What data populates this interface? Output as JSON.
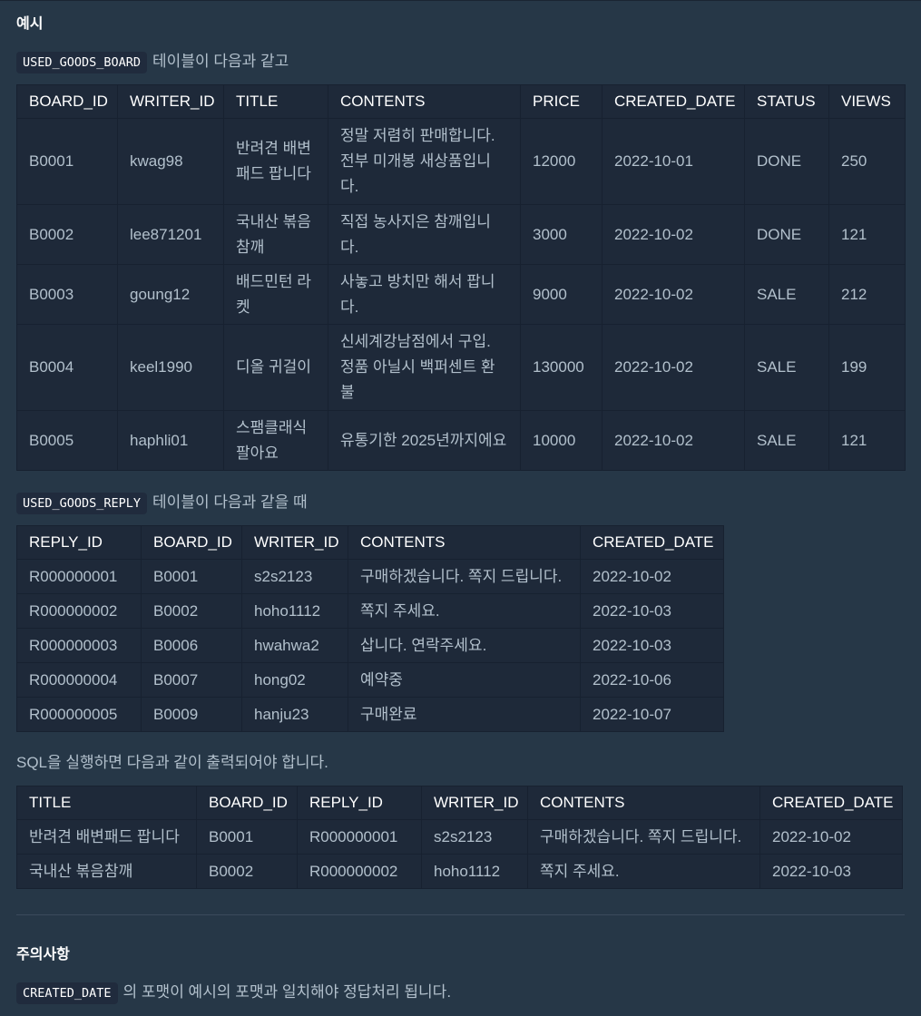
{
  "example_heading": "예시",
  "board_intro": {
    "code": "USED_GOODS_BOARD",
    "text": "테이블이 다음과 같고"
  },
  "board_table": {
    "headers": [
      "BOARD_ID",
      "WRITER_ID",
      "TITLE",
      "CONTENTS",
      "PRICE",
      "CREATED_DATE",
      "STATUS",
      "VIEWS"
    ],
    "rows": [
      [
        "B0001",
        "kwag98",
        "반려견 배변패드 팝니다",
        "정말 저렴히 판매합니다. 전부 미개봉 새상품입니다.",
        "12000",
        "2022-10-01",
        "DONE",
        "250"
      ],
      [
        "B0002",
        "lee871201",
        "국내산 볶음참깨",
        "직접 농사지은 참깨입니다.",
        "3000",
        "2022-10-02",
        "DONE",
        "121"
      ],
      [
        "B0003",
        "goung12",
        "배드민턴 라켓",
        "사놓고 방치만 해서 팝니다.",
        "9000",
        "2022-10-02",
        "SALE",
        "212"
      ],
      [
        "B0004",
        "keel1990",
        "디올 귀걸이",
        "신세계강남점에서 구입. 정품 아닐시 백퍼센트 환불",
        "130000",
        "2022-10-02",
        "SALE",
        "199"
      ],
      [
        "B0005",
        "haphli01",
        "스팸클래식 팔아요",
        "유통기한 2025년까지에요",
        "10000",
        "2022-10-02",
        "SALE",
        "121"
      ]
    ]
  },
  "reply_intro": {
    "code": "USED_GOODS_REPLY",
    "text": "테이블이 다음과 같을 때"
  },
  "reply_table": {
    "headers": [
      "REPLY_ID",
      "BOARD_ID",
      "WRITER_ID",
      "CONTENTS",
      "CREATED_DATE"
    ],
    "rows": [
      [
        "R000000001",
        "B0001",
        "s2s2123",
        "구매하겠습니다. 쪽지 드립니다.",
        "2022-10-02"
      ],
      [
        "R000000002",
        "B0002",
        "hoho1112",
        "쪽지 주세요.",
        "2022-10-03"
      ],
      [
        "R000000003",
        "B0006",
        "hwahwa2",
        "삽니다. 연락주세요.",
        "2022-10-03"
      ],
      [
        "R000000004",
        "B0007",
        "hong02",
        "예약중",
        "2022-10-06"
      ],
      [
        "R000000005",
        "B0009",
        "hanju23",
        "구매완료",
        "2022-10-07"
      ]
    ]
  },
  "result_intro": "SQL을 실행하면 다음과 같이 출력되어야 합니다.",
  "result_table": {
    "headers": [
      "TITLE",
      "BOARD_ID",
      "REPLY_ID",
      "WRITER_ID",
      "CONTENTS",
      "CREATED_DATE"
    ],
    "rows": [
      [
        "반려견 배변패드 팝니다",
        "B0001",
        "R000000001",
        "s2s2123",
        "구매하겠습니다. 쪽지 드립니다.",
        "2022-10-02"
      ],
      [
        "국내산 볶음참깨",
        "B0002",
        "R000000002",
        "hoho1112",
        "쪽지 주세요.",
        "2022-10-03"
      ]
    ]
  },
  "notes_heading": "주의사항",
  "note": {
    "code": "CREATED_DATE",
    "text": "의 포맷이 예시의 포맷과 일치해야 정답처리 됩니다."
  }
}
